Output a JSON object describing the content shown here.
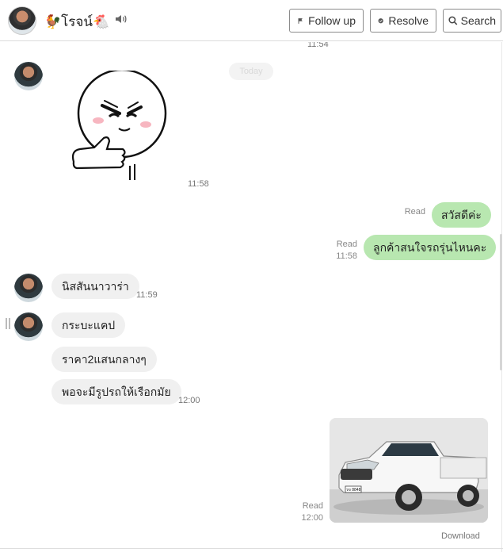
{
  "header": {
    "name": "🐓โรจน์🐔",
    "follow_up_label": "Follow up",
    "resolve_label": "Resolve",
    "search_label": "Search"
  },
  "messages": {
    "top_time": "11:54",
    "date_divider": "Today",
    "sticker_time": "11:58",
    "out1": {
      "text": "สวัสดีค่ะ",
      "status": "Read"
    },
    "out2": {
      "text": "ลูกค้าสนใจรถรุ่นไหนคะ",
      "status": "Read",
      "time": "11:58"
    },
    "in1": {
      "text": "นิสสันนาวาร่า",
      "time": "11:59"
    },
    "in2": {
      "text": "กระบะแคป"
    },
    "in3": {
      "text": "ราคา2แสนกลางๆ"
    },
    "in4": {
      "text": "พอจะมีรูปรถให้เรือกมัย",
      "time": "12:00"
    },
    "photo": {
      "status": "Read",
      "time": "12:00",
      "download_label": "Download",
      "plate": "วข 8848"
    }
  },
  "colors": {
    "outgoing_bubble": "#b8e7b0",
    "incoming_bubble": "#f0f0f0"
  }
}
